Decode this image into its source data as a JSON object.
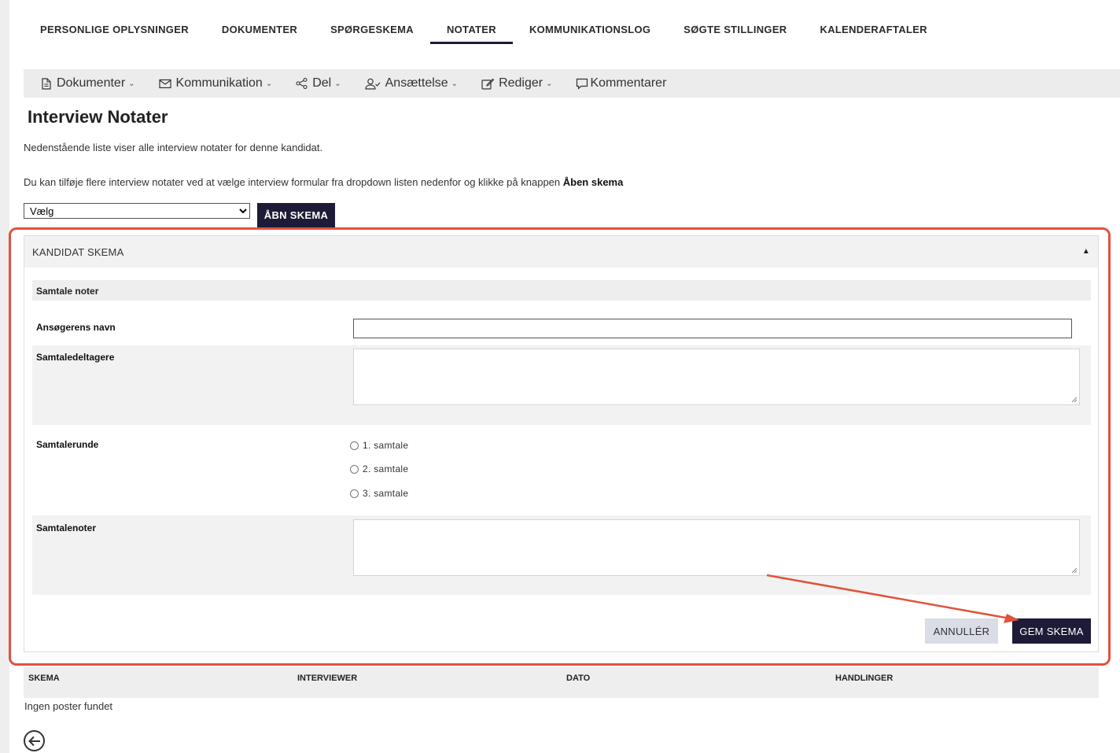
{
  "tabs": [
    {
      "label": "PERSONLIGE OPLYSNINGER",
      "active": false
    },
    {
      "label": "DOKUMENTER",
      "active": false
    },
    {
      "label": "SPØRGESKEMA",
      "active": false
    },
    {
      "label": "NOTATER",
      "active": true
    },
    {
      "label": "KOMMUNIKATIONSLOG",
      "active": false
    },
    {
      "label": "SØGTE STILLINGER",
      "active": false
    },
    {
      "label": "KALENDERAFTALER",
      "active": false
    }
  ],
  "toolbar": {
    "documents": "Dokumenter",
    "communication": "Kommunikation",
    "share": "Del",
    "employment": "Ansættelse",
    "edit": "Rediger",
    "comments": "Kommentarer"
  },
  "page": {
    "title": "Interview Notater",
    "intro": "Nedenstående liste viser alle interview notater for denne kandidat.",
    "instruction": "Du kan tilføje flere interview notater ved at vælge interview formular fra dropdown listen nedenfor og klikke på knappen ",
    "instruction_bold": "Åben skema"
  },
  "form_select": {
    "value": "Vælg",
    "button": "ÅBN SKEMA"
  },
  "panel": {
    "title": "KANDIDAT SKEMA",
    "section": "Samtale noter",
    "fields": {
      "name_label": "Ansøgerens navn",
      "name_value": "",
      "participants_label": "Samtaledeltagere",
      "round_label": "Samtalerunde",
      "notes_label": "Samtalenoter"
    },
    "round_options": [
      "1. samtale",
      "2. samtale",
      "3. samtale"
    ],
    "cancel_label": "ANNULLÉR",
    "save_label": "GEM SKEMA"
  },
  "table": {
    "columns": [
      "SKEMA",
      "INTERVIEWER",
      "DATO",
      "HANDLINGER"
    ],
    "empty": "Ingen poster fundet"
  },
  "colors": {
    "primary": "#1d1b37",
    "highlight": "#e0533d"
  }
}
